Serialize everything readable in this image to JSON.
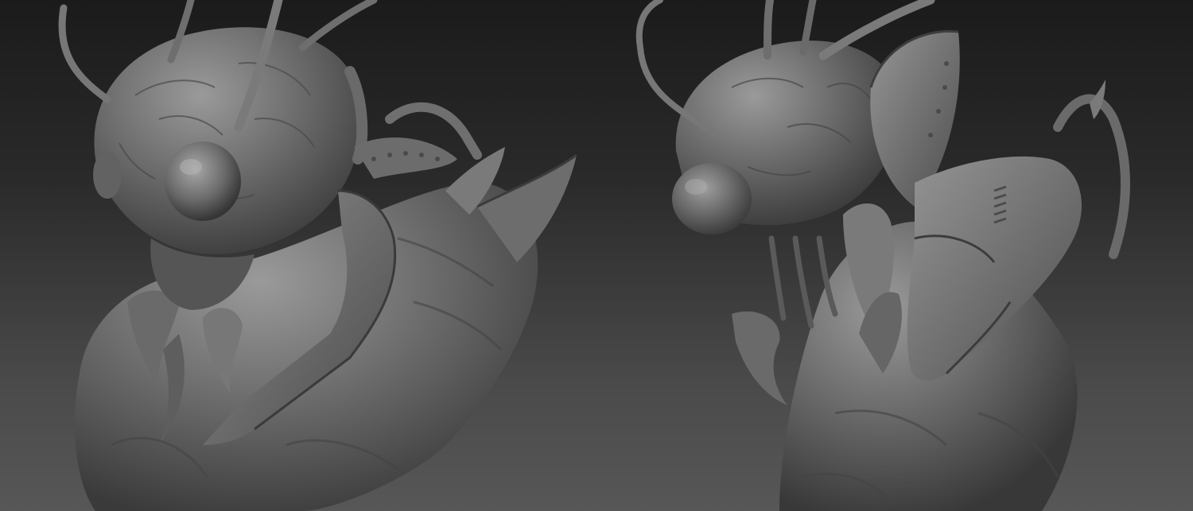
{
  "image": {
    "description_kind": "two-view render",
    "panels": [
      {
        "view": "left",
        "subject_icon": "sculpt-creature-front-three-quarter"
      },
      {
        "view": "right",
        "subject_icon": "sculpt-creature-side"
      }
    ],
    "colors": {
      "background_top": "#1b1b1b",
      "background_bottom": "#575757",
      "clay_light": "#8a8a8a",
      "clay_mid": "#6a6a6a",
      "clay_dark": "#3c3c3c"
    }
  }
}
